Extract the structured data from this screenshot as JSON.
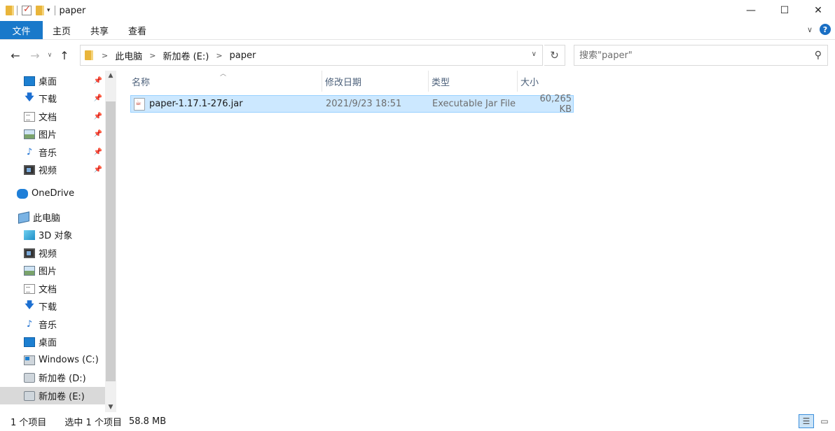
{
  "window": {
    "title": "paper",
    "controls": {
      "minimize": "—",
      "maximize": "☐",
      "close": "✕"
    }
  },
  "ribbon": {
    "tabs": [
      "文件",
      "主页",
      "共享",
      "查看"
    ],
    "expand_glyph": "∨",
    "help_glyph": "?"
  },
  "nav": {
    "back_glyph": "←",
    "forward_glyph": "→",
    "recent_glyph": "∨",
    "up_glyph": "↑"
  },
  "address": {
    "crumbs": [
      "此电脑",
      "新加卷 (E:)",
      "paper"
    ],
    "separator": ">",
    "dropdown_glyph": "∨",
    "refresh_glyph": "↻"
  },
  "search": {
    "placeholder": "搜索\"paper\"",
    "icon": "search-icon"
  },
  "sidebar": {
    "items": [
      {
        "label": "桌面",
        "icon": "desktop-icon",
        "pinned": true
      },
      {
        "label": "下载",
        "icon": "download-icon",
        "pinned": true
      },
      {
        "label": "文档",
        "icon": "document-icon",
        "pinned": true
      },
      {
        "label": "图片",
        "icon": "pictures-icon",
        "pinned": true
      },
      {
        "label": "音乐",
        "icon": "music-icon",
        "pinned": true
      },
      {
        "label": "视频",
        "icon": "video-icon",
        "pinned": true
      },
      {
        "label": "OneDrive",
        "icon": "onedrive-icon"
      },
      {
        "label": "此电脑",
        "icon": "this-pc-icon"
      },
      {
        "label": "3D 对象",
        "icon": "3d-objects-icon"
      },
      {
        "label": "视频",
        "icon": "video-icon"
      },
      {
        "label": "图片",
        "icon": "pictures-icon"
      },
      {
        "label": "文档",
        "icon": "document-icon"
      },
      {
        "label": "下载",
        "icon": "download-icon"
      },
      {
        "label": "音乐",
        "icon": "music-icon"
      },
      {
        "label": "桌面",
        "icon": "desktop-icon"
      },
      {
        "label": "Windows (C:)",
        "icon": "windows-drive-icon"
      },
      {
        "label": "新加卷 (D:)",
        "icon": "drive-icon"
      },
      {
        "label": "新加卷 (E:)",
        "icon": "drive-icon",
        "selected": true
      }
    ]
  },
  "columns": [
    "名称",
    "修改日期",
    "类型",
    "大小"
  ],
  "files": [
    {
      "name": "paper-1.17.1-276.jar",
      "modified": "2021/9/23 18:51",
      "type": "Executable Jar File",
      "size": "60,265 KB",
      "icon": "jar-file-icon"
    }
  ],
  "status": {
    "item_count": "1 个项目",
    "selection": "选中 1 个项目",
    "size": "58.8 MB"
  },
  "colors": {
    "accent": "#1979ca",
    "selection": "#cce8ff",
    "selection_border": "#99d1ff"
  }
}
